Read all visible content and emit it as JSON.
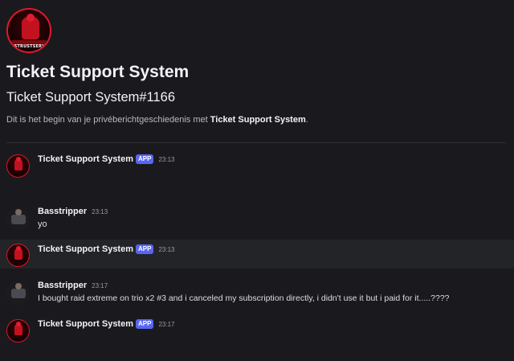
{
  "bot": {
    "name": "Ticket Support System",
    "handle": "Ticket Support System#1166",
    "avatar_label": "BESTRUSTSERVER",
    "badge": "APP"
  },
  "intro": {
    "prefix": "Dit is het begin van je privéberichtgeschiedenis met ",
    "name": "Ticket Support System",
    "suffix": "."
  },
  "messages": [
    {
      "author": "Ticket Support System",
      "badge": "APP",
      "time": "23:13",
      "text": ""
    },
    {
      "author": "Basstripper",
      "badge": "",
      "time": "23:13",
      "text": "yo"
    },
    {
      "author": "Ticket Support System",
      "badge": "APP",
      "time": "23:13",
      "text": ""
    },
    {
      "author": "Basstripper",
      "badge": "",
      "time": "23:17",
      "text": "I bought raid extreme on trio x2 #3 and i canceled my subscription directly, i didn't use it but i paid for it.....????"
    },
    {
      "author": "Ticket Support System",
      "badge": "APP",
      "time": "23:17",
      "text": ""
    }
  ],
  "colors": {
    "background": "#1a1a1e",
    "highlight": "#232428",
    "badge": "#5865f2",
    "avatar_ring": "#e0182d"
  },
  "icons": {
    "bot_avatar": "bot-avatar-icon",
    "user_avatar": "user-avatar-icon"
  }
}
